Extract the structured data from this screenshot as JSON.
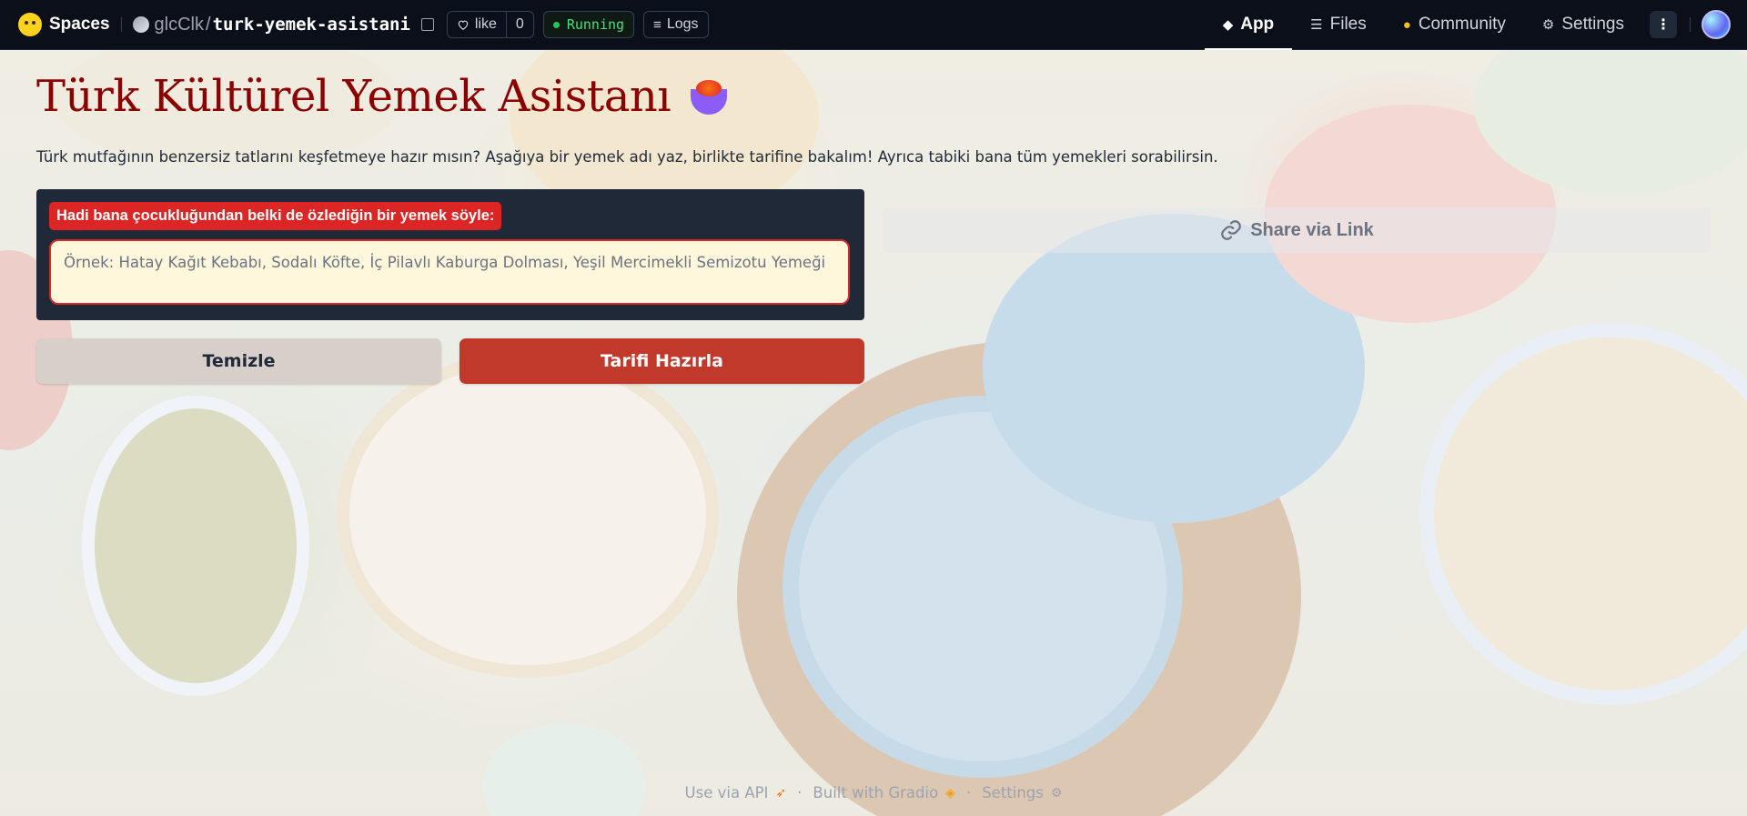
{
  "topbar": {
    "brand": "Spaces",
    "owner": "glcClk",
    "slash": "/",
    "repo_name": "turk-yemek-asistani",
    "like_label": "like",
    "like_count": "0",
    "status": "Running",
    "logs_label": "Logs",
    "nav": {
      "app": "App",
      "files": "Files",
      "community": "Community",
      "settings": "Settings"
    }
  },
  "app": {
    "title": "Türk Kültürel Yemek Asistanı",
    "subtitle": "Türk mutfağının benzersiz tatlarını keşfetmeye hazır mısın? Aşağıya bir yemek adı yaz, birlikte tarifine bakalım! Ayrıca tabiki bana tüm yemekleri sorabilirsin.",
    "input_label": "Hadi bana çocukluğundan belki de özlediğin bir yemek söyle:",
    "input_placeholder": "Örnek: Hatay Kağıt Kebabı, Sodalı Köfte, İç Pilavlı Kaburga Dolması, Yeşil Mercimekli Semizotu Yemeği",
    "input_value": "",
    "clear_button": "Temizle",
    "submit_button": "Tarifi Hazırla",
    "share_button": "Share via Link"
  },
  "footer": {
    "api": "Use via API",
    "built": "Built with Gradio",
    "settings": "Settings",
    "separator": "·"
  },
  "colors": {
    "title": "#8b0000",
    "accent_red": "#dc2626",
    "submit_bg": "#c0392b",
    "topbar_bg": "#0b0f19",
    "status_green": "#22c55e"
  }
}
